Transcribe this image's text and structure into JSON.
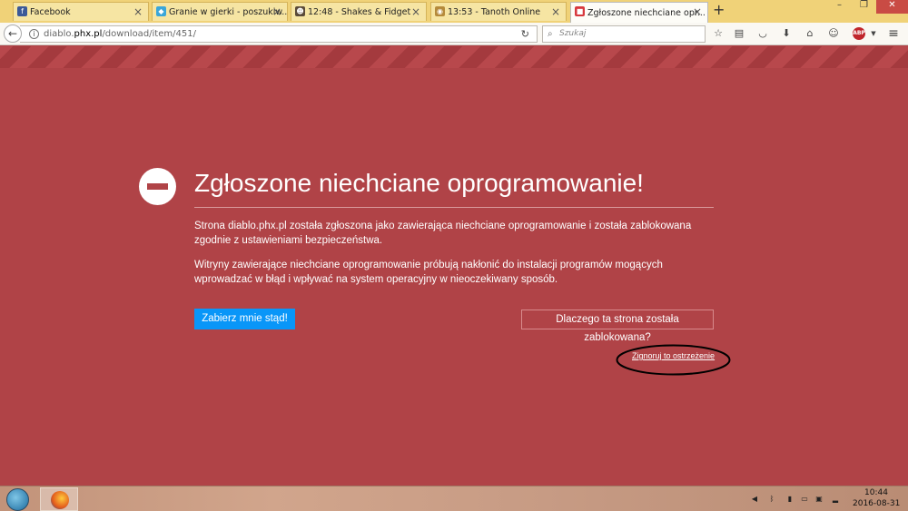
{
  "tabs": [
    {
      "label": "Facebook",
      "icon": "facebook-icon",
      "icon_glyph": "f",
      "icon_color": "#3b5998",
      "close": "×"
    },
    {
      "label": "Granie w gierki - poszukiw...",
      "icon": "bird-icon",
      "icon_glyph": "◆",
      "icon_color": "#3aa6d9",
      "close": "×"
    },
    {
      "label": "12:48 - Shakes & Fidget",
      "icon": "character-icon",
      "icon_glyph": "☻",
      "icon_color": "#5a4a38",
      "close": "×"
    },
    {
      "label": "13:53 - Tanoth Online",
      "icon": "tanoth-icon",
      "icon_glyph": "◉",
      "icon_color": "#b58a3a",
      "close": "×"
    },
    {
      "label": "Zgłoszone niechciane opr...",
      "icon": "warning-page-icon",
      "icon_glyph": "■",
      "icon_color": "#d7383d",
      "close": "×"
    }
  ],
  "new_tab": "+",
  "window_controls": {
    "minimize": "–",
    "maximize": "❐",
    "close": "✕"
  },
  "nav": {
    "back": "←",
    "url_prefix": "diablo.",
    "url_domain": "phx.pl",
    "url_path": "/download/item/451/",
    "reload": "↻",
    "search_placeholder": "Szukaj",
    "search_glyph": "⌕"
  },
  "toolbar_icons": [
    {
      "name": "bookmark-star-icon",
      "glyph": "☆"
    },
    {
      "name": "reading-list-icon",
      "glyph": "▤"
    },
    {
      "name": "pocket-icon",
      "glyph": "◡"
    },
    {
      "name": "downloads-icon",
      "glyph": "⬇"
    },
    {
      "name": "home-icon",
      "glyph": "⌂"
    },
    {
      "name": "hello-icon",
      "glyph": "☺"
    }
  ],
  "abp_label": "ABP",
  "menu_glyph": "≡",
  "error": {
    "title": "Zgłoszone niechciane oprogramowanie!",
    "para1": "Strona diablo.phx.pl została zgłoszona jako zawierająca niechciane oprogramowanie i została zablokowana zgodnie z ustawieniami bezpieczeństwa.",
    "para2": "Witryny zawierające niechciane oprogramowanie próbują nakłonić do instalacji programów mogących wprowadzać w błąd i wpływać na system operacyjny w nieoczekiwany sposób.",
    "get_me_out": "Zabierz mnie stąd!",
    "why_blocked": "Dlaczego ta strona została zablokowana?",
    "ignore": "Zignoruj to ostrzeżenie"
  },
  "colors": {
    "background": "#b04347",
    "primary_button": "#0996f8",
    "annotation": "#000000"
  },
  "taskbar": {
    "time": "10:44",
    "date": "2016-08-31",
    "tray": [
      {
        "name": "volume-icon",
        "glyph": "◀"
      },
      {
        "name": "bluetooth-icon",
        "glyph": "ᛒ"
      },
      {
        "name": "battery-icon",
        "glyph": "▮"
      },
      {
        "name": "display-icon",
        "glyph": "▭"
      },
      {
        "name": "network-icon",
        "glyph": "▣"
      },
      {
        "name": "signal-icon",
        "glyph": "▂"
      }
    ]
  }
}
